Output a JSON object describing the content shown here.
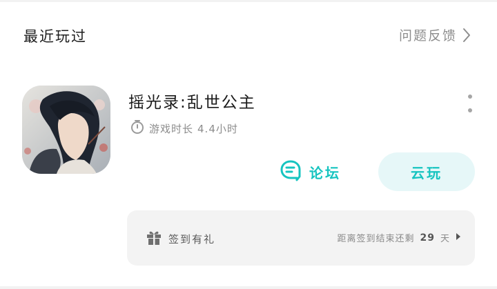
{
  "section": {
    "title": "最近玩过",
    "feedback_label": "问题反馈",
    "feedback_icon": "chevron-right-icon"
  },
  "game": {
    "title": "摇光录:乱世公主",
    "playtime_label": "游戏时长",
    "playtime_value": "4.4小时",
    "icon": "game-app-icon",
    "more_icon": "more-vertical-icon"
  },
  "actions": {
    "forum_label": "论坛",
    "forum_icon": "chat-bubble-icon",
    "cloud_label": "云玩"
  },
  "checkin": {
    "label": "签到有礼",
    "icon": "gift-icon",
    "remaining_prefix": "距离签到结束还剩",
    "remaining_days": "29",
    "remaining_suffix": "天",
    "arrow_icon": "caret-right-icon"
  },
  "colors": {
    "accent": "#16c4c0",
    "accent_bg": "#e6f7f8",
    "muted_text": "#8c8c8c",
    "panel_bg": "#f3f3f3"
  }
}
